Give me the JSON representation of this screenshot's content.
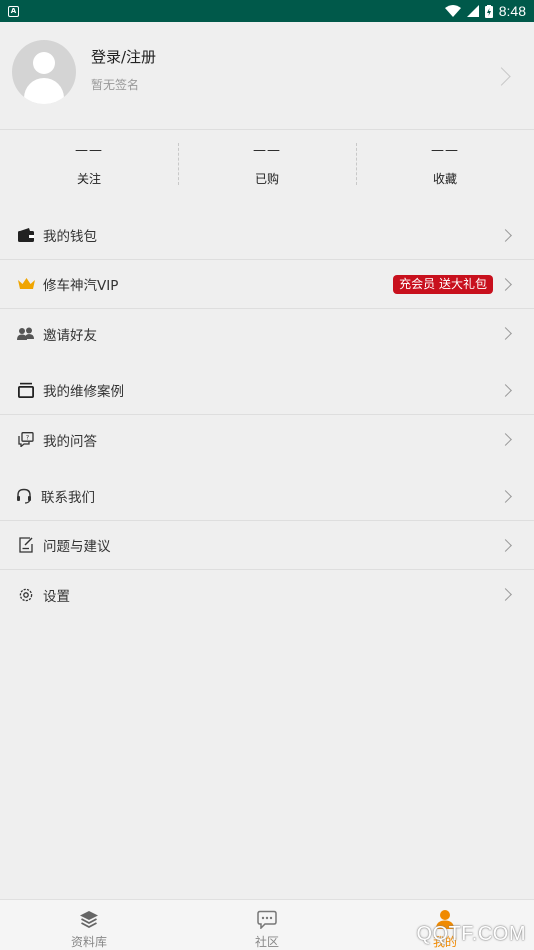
{
  "status_bar": {
    "app_icon": "A",
    "time": "8:48"
  },
  "profile": {
    "name": "登录/注册",
    "signature": "暂无签名"
  },
  "stats": [
    {
      "value": "——",
      "label": "关注"
    },
    {
      "value": "——",
      "label": "已购"
    },
    {
      "value": "——",
      "label": "收藏"
    }
  ],
  "menu": {
    "wallet": "我的钱包",
    "vip": "修车神汽VIP",
    "vip_badge": "充会员 送大礼包",
    "invite": "邀请好友",
    "cases": "我的维修案例",
    "qa": "我的问答",
    "contact": "联系我们",
    "feedback": "问题与建议",
    "settings": "设置"
  },
  "tabs": [
    {
      "label": "资料库",
      "icon": "layers-icon"
    },
    {
      "label": "社区",
      "icon": "chat-icon"
    },
    {
      "label": "我的",
      "icon": "person-icon",
      "active": true
    }
  ],
  "watermark": "QQTF.COM",
  "colors": {
    "status_bar": "#00594a",
    "accent": "#f08a00",
    "badge": "#c8101d",
    "background": "#efefef"
  }
}
